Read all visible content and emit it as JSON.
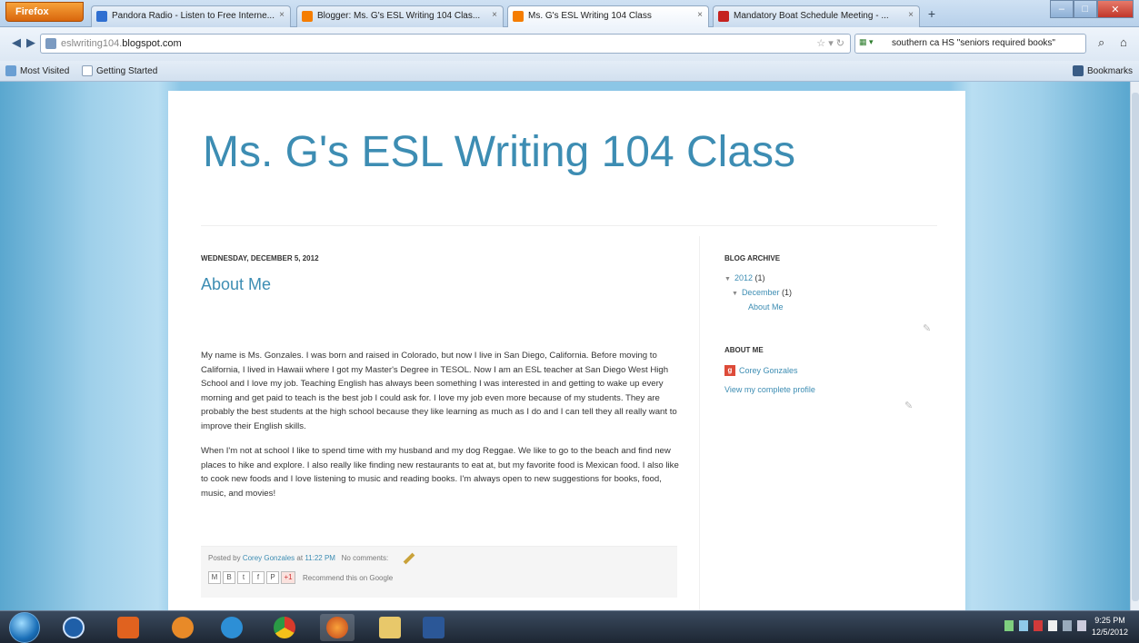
{
  "browser": {
    "app_button": "Firefox",
    "tabs": [
      {
        "label": "Pandora Radio - Listen to Free Interne...",
        "favicon_color": "#2f6fd1"
      },
      {
        "label": "Blogger: Ms. G's ESL Writing 104 Clas...",
        "favicon_color": "#f57d00"
      },
      {
        "label": "Ms. G's ESL Writing 104 Class",
        "favicon_color": "#f57d00"
      },
      {
        "label": "Mandatory Boat Schedule Meeting - ...",
        "favicon_color": "#c5221f"
      }
    ],
    "new_tab": "+",
    "url_prefix": "eslwriting104.",
    "url_domain": "blogspot.com",
    "search_value": "southern ca HS \"seniors required books\"",
    "bookmarks": [
      {
        "label": "Most Visited"
      },
      {
        "label": "Getting Started"
      }
    ],
    "bookmarks_menu": "Bookmarks"
  },
  "blog": {
    "title": "Ms. G's ESL Writing 104 Class",
    "date_header": "WEDNESDAY, DECEMBER 5, 2012",
    "post_title": "About Me",
    "paragraphs": [
      "My name is Ms. Gonzales. I was born and raised in Colorado, but now I live in San Diego, California. Before moving to California, I lived in Hawaii where I got my Master's Degree in TESOL. Now I am an ESL teacher at San Diego West High School and I love my job. Teaching English has always been something I was interested in and getting to wake up every morning and get paid to teach is the best job I could ask for. I love my job even more because of my students. They are probably the best students at the high school because they like learning as much as I do and I can tell they all really want to improve their English skills.",
      "When I'm not at school I like to spend time with my husband and my dog Reggae. We like to go to the beach and find new places to hike and explore. I also really like finding new restaurants to eat at, but my favorite food is Mexican food. I also like to cook new foods and I love listening to music and reading books. I'm always open to new suggestions for books, food, music, and movies!"
    ],
    "footer": {
      "posted_by": "Posted by",
      "author": "Corey Gonzales",
      "at": "at",
      "time": "11:22 PM",
      "comments": "No comments:",
      "share_buttons": [
        "M",
        "B",
        "t",
        "f",
        "P",
        "+1"
      ],
      "recommend": "Recommend this on Google"
    },
    "sidebar": {
      "archive_heading": "BLOG ARCHIVE",
      "year": "2012",
      "year_count": "(1)",
      "month": "December",
      "month_count": "(1)",
      "post_link": "About Me",
      "about_heading": "ABOUT ME",
      "profile_name": "Corey Gonzales",
      "profile_link": "View my complete profile"
    }
  },
  "taskbar": {
    "clock_time": "9:25 PM",
    "clock_date": "12/5/2012"
  },
  "colors": {
    "accent": "#3d8db3",
    "page_bg": "#8cc6e6"
  }
}
